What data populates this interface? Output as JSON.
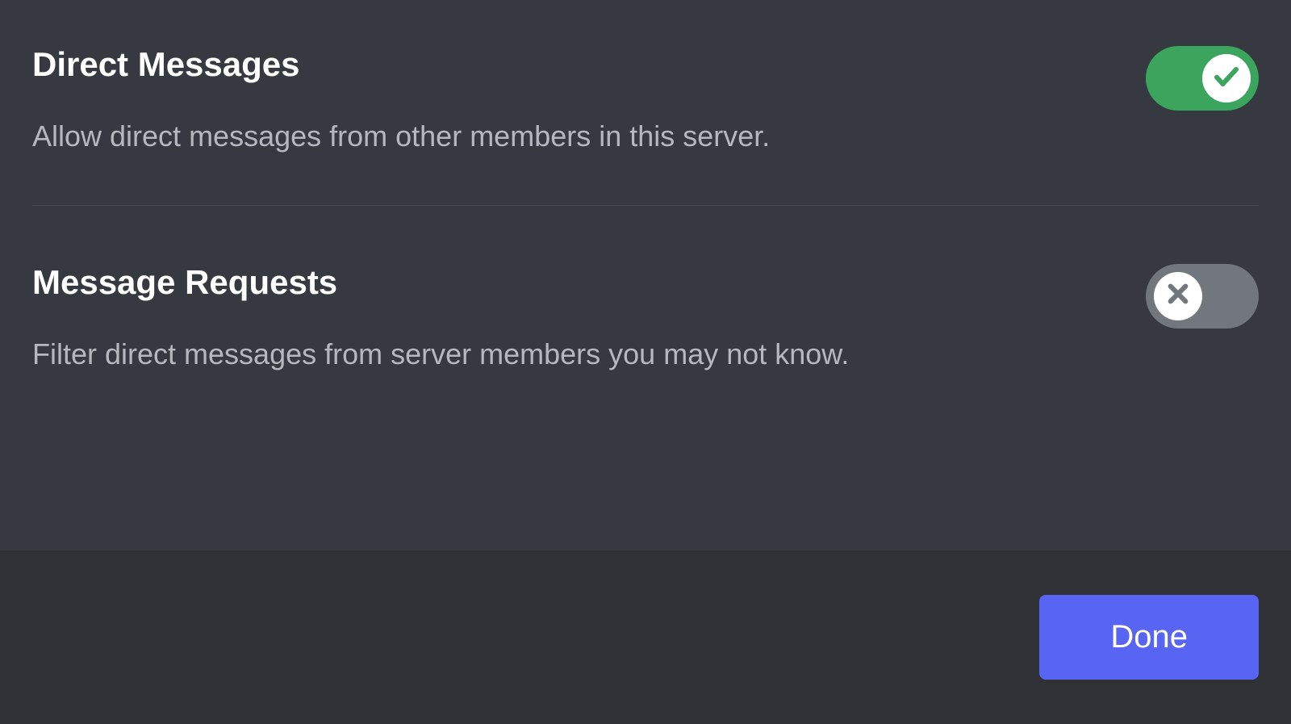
{
  "settings": [
    {
      "title": "Direct Messages",
      "description": "Allow direct messages from other members in this server.",
      "enabled": true
    },
    {
      "title": "Message Requests",
      "description": "Filter direct messages from server members you may not know.",
      "enabled": false
    }
  ],
  "footer": {
    "done_label": "Done"
  },
  "colors": {
    "toggle_on": "#3ba55d",
    "toggle_off": "#72767d",
    "button_primary": "#5865f2",
    "bg_main": "#36393f",
    "bg_footer": "#2f3136"
  }
}
